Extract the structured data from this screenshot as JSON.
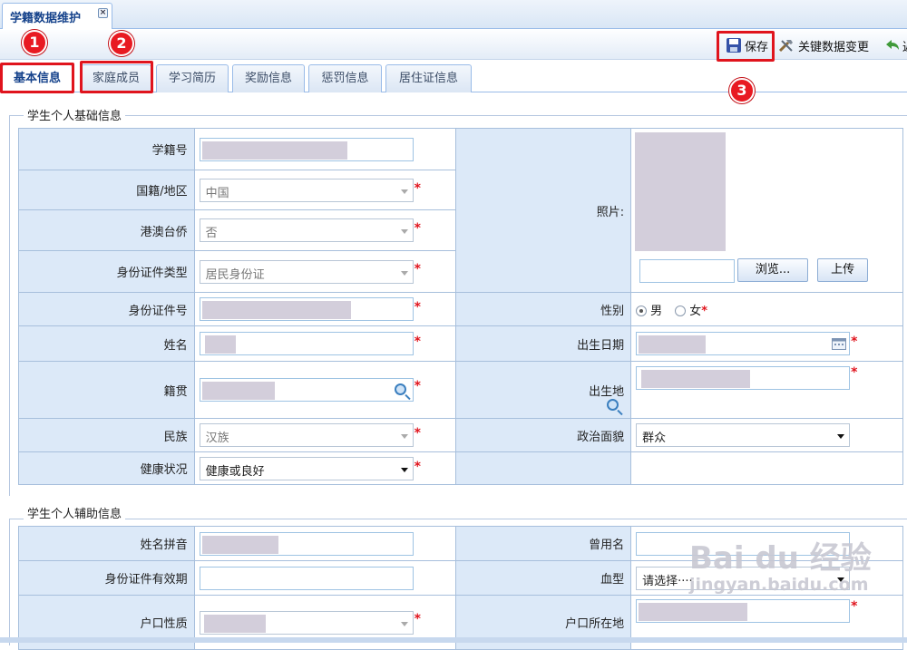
{
  "window_tab": {
    "title": "学籍数据维护",
    "close": "×"
  },
  "toolbar": {
    "save": "保存",
    "key_change": "关键数据变更",
    "back_partial": "返"
  },
  "subtabs": [
    "基本信息",
    "家庭成员",
    "学习简历",
    "奖励信息",
    "惩罚信息",
    "居住证信息"
  ],
  "badges": [
    "1",
    "2",
    "3"
  ],
  "section1": {
    "legend": "学生个人基础信息",
    "labels": {
      "student_no": "学籍号",
      "nationality": "国籍/地区",
      "hkmo": "港澳台侨",
      "id_type": "身份证件类型",
      "id_no": "身份证件号",
      "name": "姓名",
      "native_place": "籍贯",
      "ethnicity": "民族",
      "health": "健康状况",
      "photo": "照片:",
      "gender": "性别",
      "birth_date": "出生日期",
      "birth_place": "出生地",
      "political": "政治面貌"
    },
    "values": {
      "nationality": "中国",
      "hkmo": "否",
      "id_type": "居民身份证",
      "ethnicity": "汉族",
      "health": "健康或良好",
      "political": "群众",
      "gender_male": "男",
      "gender_female": "女"
    },
    "buttons": {
      "browse": "浏览...",
      "upload": "上传"
    },
    "required_mark": "*"
  },
  "section2": {
    "legend": "学生个人辅助信息",
    "labels": {
      "pinyin": "姓名拼音",
      "former_name": "曾用名",
      "id_validity": "身份证件有效期",
      "blood_type": "血型",
      "hukou_type": "户口性质",
      "hukou_location": "户口所在地"
    },
    "values": {
      "blood_type": "请选择····"
    }
  },
  "watermark": {
    "line1": "Bai du 经验",
    "line2": "jingyan.baidu.com"
  },
  "colors": {
    "highlight": "#e0141d",
    "label_bg": "#dce9f8",
    "border": "#a7bfdc"
  }
}
